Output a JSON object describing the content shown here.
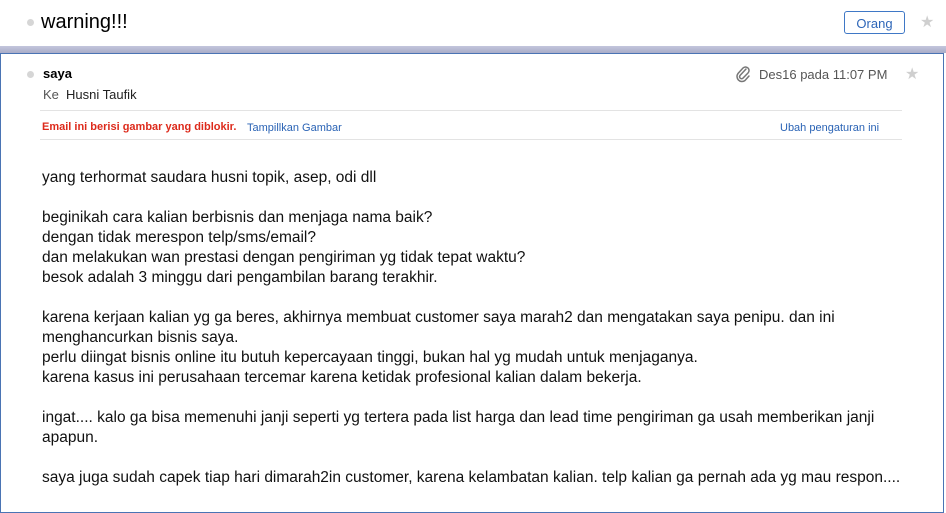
{
  "header": {
    "subject": "warning!!!",
    "label_button": "Orang"
  },
  "message": {
    "sender": "saya",
    "to_label": "Ke",
    "to_name": "Husni Taufik",
    "date": "Des16 pada 11:07 PM",
    "blocked_notice": "Email ini berisi gambar yang diblokir.",
    "show_images": "Tampillkan Gambar",
    "change_settings": "Ubah pengaturan ini"
  },
  "body": {
    "p1": "yang terhormat saudara husni topik, asep, odi dll",
    "p2": [
      "beginikah cara kalian berbisnis dan menjaga nama baik?",
      "dengan tidak merespon telp/sms/email?",
      "dan melakukan wan prestasi dengan pengiriman yg tidak tepat waktu?",
      "besok adalah 3 minggu dari pengambilan barang terakhir."
    ],
    "p3": [
      "karena kerjaan kalian yg ga beres, akhirnya membuat customer saya marah2 dan mengatakan saya penipu. dan ini menghancurkan bisnis saya.",
      "perlu diingat bisnis online itu butuh kepercayaan tinggi, bukan hal yg mudah untuk menjaganya.",
      "karena kasus ini perusahaan tercemar karena ketidak profesional kalian dalam bekerja."
    ],
    "p4": "ingat.... kalo ga bisa memenuhi janji seperti yg tertera pada list harga dan lead time pengiriman ga usah memberikan janji apapun.",
    "p5": "saya juga sudah capek tiap hari dimarah2in customer, karena kelambatan kalian. telp kalian ga pernah ada yg mau respon...."
  }
}
